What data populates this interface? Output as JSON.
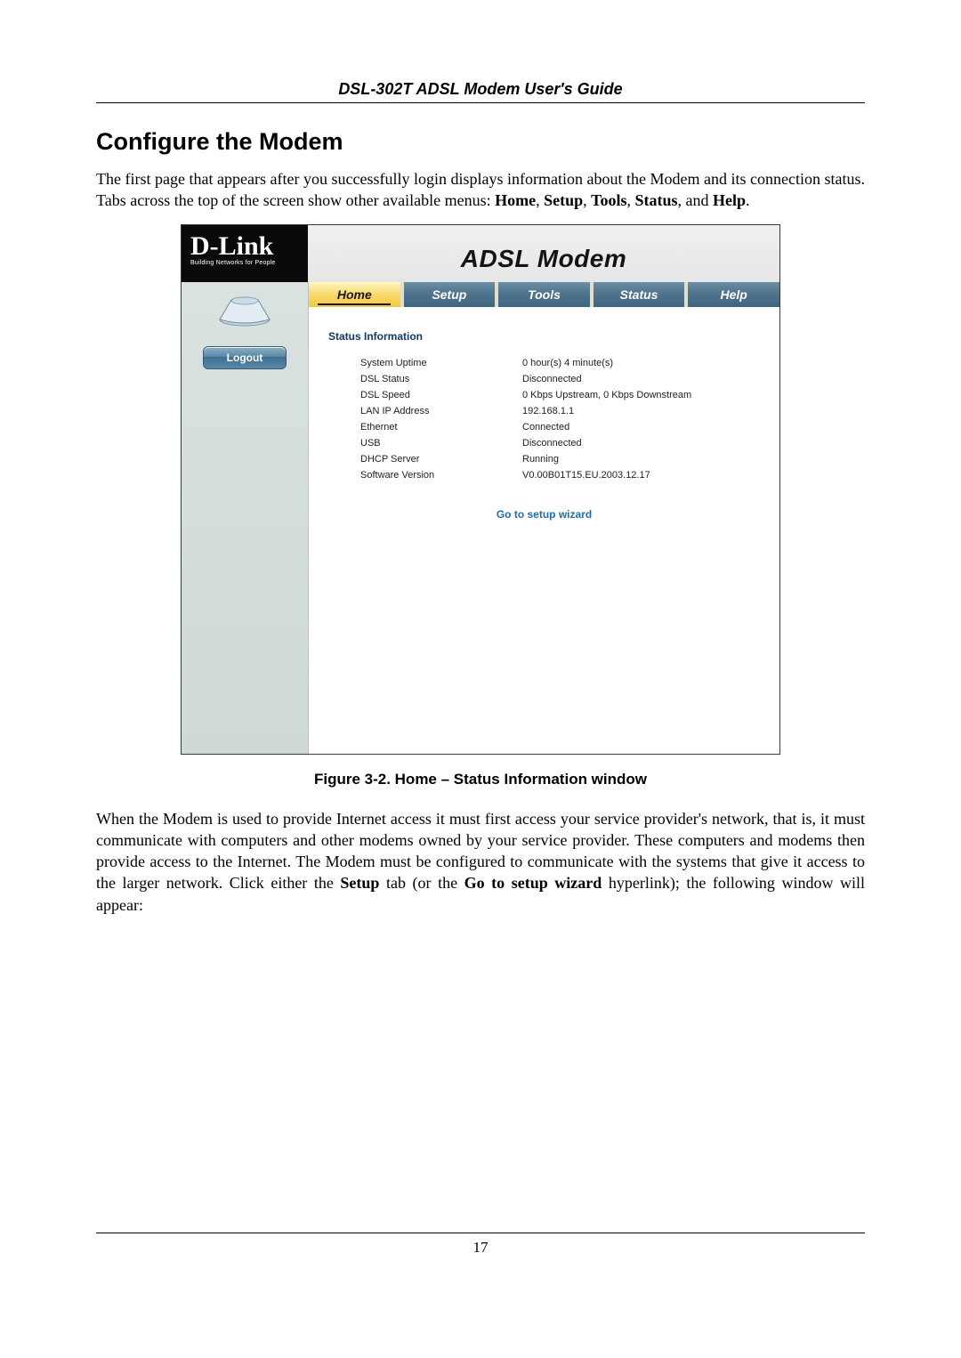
{
  "doc": {
    "header": "DSL-302T ADSL Modem User's Guide",
    "sectionTitle": "Configure the Modem",
    "para1_a": "The first page that appears after you successfully login displays information about the Modem and its connection status. Tabs across the top of the screen show other available menus: ",
    "para1_b1": "Home",
    "para1_b2": "Setup",
    "para1_b3": "Tools",
    "para1_b4": "Status",
    "para1_b5": "Help",
    "figureCaption": "Figure 3-2. Home – Status Information window",
    "para2_a": "When the Modem is used to provide Internet access it must first access your service provider's network, that is, it must communicate with computers and other modems owned by your service provider. These computers and modems then provide access to the Internet. The Modem must be configured to communicate with the systems that give it access to the larger network. Click either the ",
    "para2_b1": "Setup",
    "para2_mid": " tab (or the ",
    "para2_b2": "Go to setup wizard",
    "para2_end": " hyperlink); the following window will appear:",
    "pageNumber": "17"
  },
  "ui": {
    "brand": "D-Link",
    "brandTag": "Building Networks for People",
    "title": "ADSL Modem",
    "logout": "Logout",
    "tabs": [
      "Home",
      "Setup",
      "Tools",
      "Status",
      "Help"
    ],
    "sectionTitle": "Status Information",
    "rows": [
      {
        "k": "System Uptime",
        "v": "0 hour(s) 4 minute(s)"
      },
      {
        "k": "DSL Status",
        "v": "Disconnected"
      },
      {
        "k": "DSL Speed",
        "v": "0 Kbps Upstream, 0 Kbps Downstream"
      },
      {
        "k": "LAN IP Address",
        "v": "192.168.1.1"
      },
      {
        "k": "Ethernet",
        "v": "Connected"
      },
      {
        "k": "USB",
        "v": "Disconnected"
      },
      {
        "k": "DHCP Server",
        "v": "Running"
      },
      {
        "k": "Software Version",
        "v": "V0.00B01T15.EU.2003.12.17"
      }
    ],
    "wizardLink": "Go to setup wizard"
  }
}
